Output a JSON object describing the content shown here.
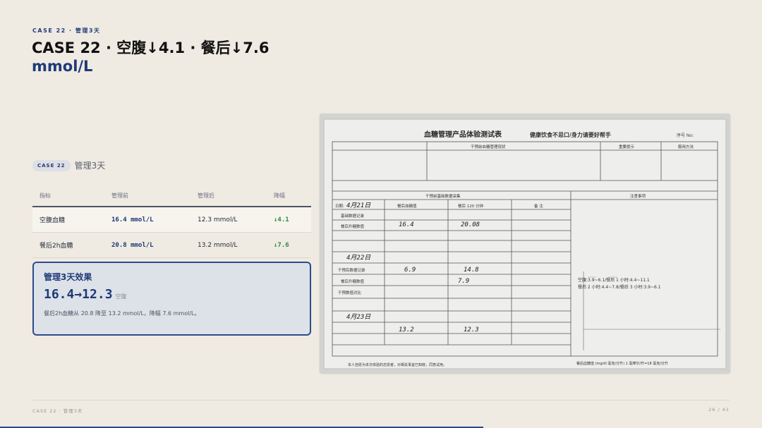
{
  "header": {
    "kicker": "CASE 22 · 管理3天",
    "title_line1": "CASE 22 · 空腹↓4.1 · 餐后↓7.6",
    "title_line2": "mmol/L"
  },
  "case_tag": {
    "label": "CASE 22",
    "text": "管理3天"
  },
  "table": {
    "headers": [
      "指标",
      "管理前",
      "管理后",
      "降幅"
    ],
    "rows": [
      {
        "metric": "空腹血糖",
        "before": "16.4 mmol/L",
        "after": "12.3 mmol/L",
        "drop": "↓4.1"
      },
      {
        "metric": "餐后2h血糖",
        "before": "20.8 mmol/L",
        "after": "13.2 mmol/L",
        "drop": "↓7.6"
      }
    ]
  },
  "effect_card": {
    "title": "管理3天效果",
    "value": "16.4→12.3",
    "unit": "空腹",
    "description": "餐后2h血糖从 20.8 降至 13.2 mmol/L，降幅 7.6 mmol/L。"
  },
  "photo": {
    "form_title": "血糖管理产品体验测试表",
    "slogan": "健康饮食不忌口/身力请要好帮手",
    "serial_label": "序号 No:",
    "section_monitor": "干预前血糖管理现状",
    "section_notes": "重要提示",
    "section_method": "服用方法",
    "baseline_section": "干预前基础数据采集",
    "notice_label": "注意事项",
    "date_label": "日期:",
    "fasting_label": "餐后血糖值",
    "post120_label": "餐后 120 分钟",
    "remark_label": "备 注",
    "row_baseline": "基础数据记录",
    "row_rise": "餐后升糖数值",
    "row_intervene": "干预后数据记录",
    "row_rise2": "餐后升糖数值",
    "row_compare": "干预数值对比",
    "record1_date": "4月21日",
    "record1_fasting": "16.4",
    "record1_post": "20.08",
    "record2_date": "4月22日",
    "record2_fasting": "6.9",
    "record2_post": "14.8",
    "record2_post2": "7.9",
    "record3_date": "4月23日",
    "record3_fasting": "13.2",
    "record3_post": "12.3",
    "chart_label": "餐后血糖值 (mg/dl 毫克/分升) 1 毫摩尔/升=18 毫克/分升",
    "ref_text1": "空腹:3.9~6.1/餐后 1 小时:4.4~11.1",
    "ref_text2": "餐后 2 小时:4.4~7.8/餐后 3 小时:3.9~6.1",
    "bottom_note": "本人自愿为本次体验的志愿者，对相关事宜已知晓，同意试用。"
  },
  "footer": {
    "left": "CASE 22 · 管理3天",
    "right": "26 / 41"
  },
  "progress": 0.634
}
